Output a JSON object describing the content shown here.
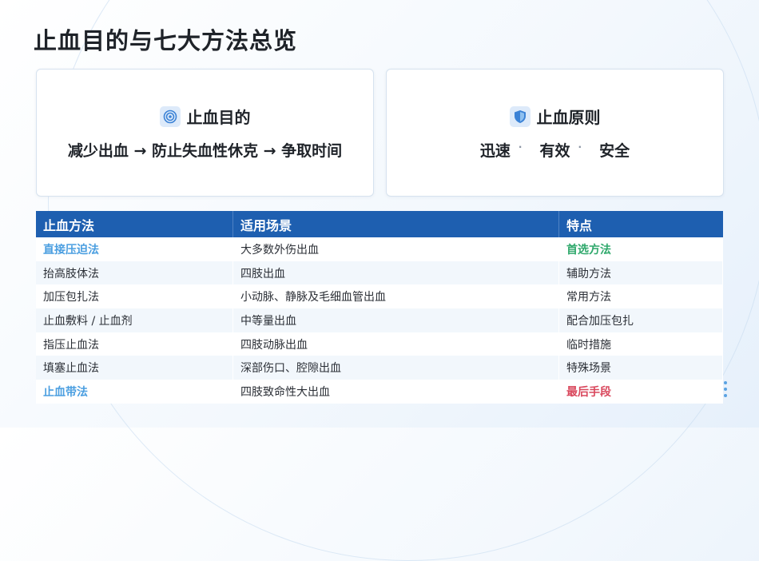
{
  "page": {
    "title": "止血目的与七大方法总览"
  },
  "cards": {
    "purpose": {
      "icon": "target-icon",
      "title": "止血目的",
      "text": "减少出血 → 防止失血性休克 → 争取时间"
    },
    "principle": {
      "icon": "shield-icon",
      "title": "止血原则",
      "items": [
        "迅速",
        "有效",
        "安全"
      ],
      "separator": "·"
    }
  },
  "table": {
    "headers": [
      "止血方法",
      "适用场景",
      "特点"
    ],
    "rows": [
      {
        "method": "直接压迫法",
        "scene": "大多数外伤出血",
        "feature": "首选方法",
        "method_style": "blue",
        "feature_style": "green"
      },
      {
        "method": "抬高肢体法",
        "scene": "四肢出血",
        "feature": "辅助方法"
      },
      {
        "method": "加压包扎法",
        "scene": "小动脉、静脉及毛细血管出血",
        "feature": "常用方法"
      },
      {
        "method": "止血敷料 / 止血剂",
        "scene": "中等量出血",
        "feature": "配合加压包扎"
      },
      {
        "method": "指压止血法",
        "scene": "四肢动脉出血",
        "feature": "临时措施"
      },
      {
        "method": "填塞止血法",
        "scene": "深部伤口、腔隙出血",
        "feature": "特殊场景"
      },
      {
        "method": "止血带法",
        "scene": "四肢致命性大出血",
        "feature": "最后手段",
        "method_style": "blue",
        "feature_style": "red"
      }
    ]
  },
  "colors": {
    "header_bg": "#1e5fb0",
    "highlight_blue": "#4a9ee0",
    "highlight_green": "#2ea86b",
    "highlight_red": "#d9475c"
  }
}
